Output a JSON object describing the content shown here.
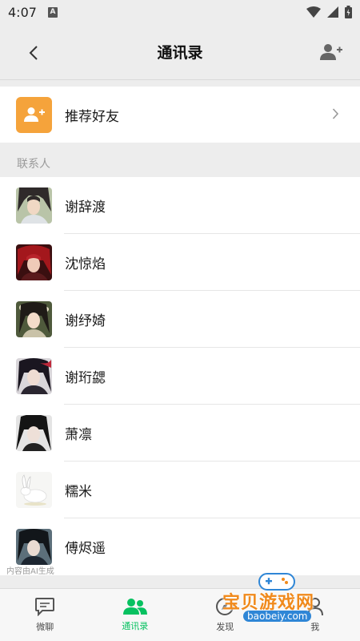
{
  "status": {
    "time": "4:07",
    "notify_icon_label": "A"
  },
  "header": {
    "title": "通讯录"
  },
  "recommend": {
    "label": "推荐好友"
  },
  "contacts_section": {
    "label": "联系人"
  },
  "contacts": [
    {
      "name": "谢辞渡",
      "avatar": "portrait-avatar-1"
    },
    {
      "name": "沈惊焰",
      "avatar": "portrait-avatar-2"
    },
    {
      "name": "谢纾婍",
      "avatar": "portrait-avatar-3"
    },
    {
      "name": "谢珩勰",
      "avatar": "portrait-avatar-4"
    },
    {
      "name": "萧凛",
      "avatar": "portrait-avatar-5"
    },
    {
      "name": "糯米",
      "avatar": "rabbit-avatar"
    },
    {
      "name": "傅烬遥",
      "avatar": "portrait-avatar-7"
    }
  ],
  "ai_note": "内容由AI生成",
  "tabs": [
    {
      "label": "微聊",
      "icon": "chat-icon",
      "active": false
    },
    {
      "label": "通讯录",
      "icon": "contacts-icon",
      "active": true
    },
    {
      "label": "发现",
      "icon": "discover-icon",
      "active": false
    },
    {
      "label": "我",
      "icon": "me-icon",
      "active": false
    }
  ],
  "watermark": {
    "text": "宝贝游戏网",
    "url": "baobeiy.com"
  },
  "colors": {
    "accent": "#07c160",
    "recommend_icon_bg": "#f5a33b",
    "background": "#ededed"
  }
}
